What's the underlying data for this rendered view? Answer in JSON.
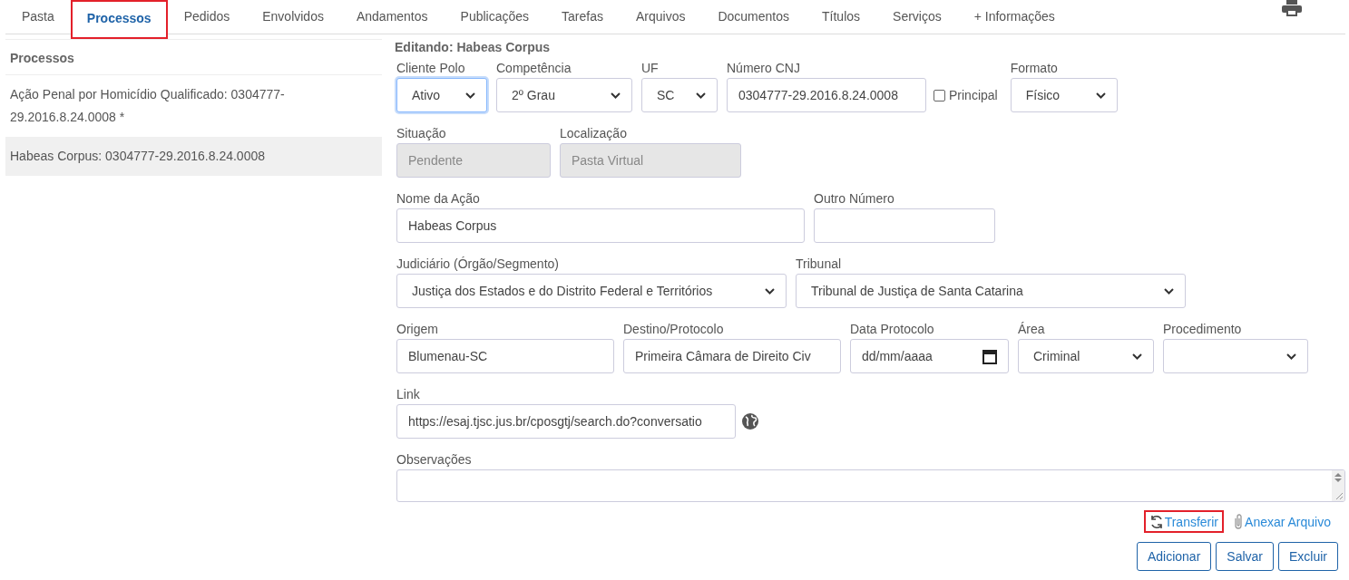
{
  "tabs": [
    {
      "label": "Pasta",
      "selected": false,
      "highlighted": false
    },
    {
      "label": "Processos",
      "selected": true,
      "highlighted": true
    },
    {
      "label": "Pedidos",
      "selected": false,
      "highlighted": false
    },
    {
      "label": "Envolvidos",
      "selected": false,
      "highlighted": false
    },
    {
      "label": "Andamentos",
      "selected": false,
      "highlighted": false
    },
    {
      "label": "Publicações",
      "selected": false,
      "highlighted": false
    },
    {
      "label": "Tarefas",
      "selected": false,
      "highlighted": false
    },
    {
      "label": "Arquivos",
      "selected": false,
      "highlighted": false
    },
    {
      "label": "Documentos",
      "selected": false,
      "highlighted": false
    },
    {
      "label": "Títulos",
      "selected": false,
      "highlighted": false
    },
    {
      "label": "Serviços",
      "selected": false,
      "highlighted": false
    },
    {
      "label": "+ Informações",
      "selected": false,
      "highlighted": false
    }
  ],
  "sidebar": {
    "title": "Processos",
    "items": [
      {
        "label": "Ação Penal por Homicídio Qualificado: 0304777-29.2016.8.24.0008 *",
        "selected": false
      },
      {
        "label": "Habeas Corpus: 0304777-29.2016.8.24.0008",
        "selected": true
      }
    ]
  },
  "form": {
    "title": "Editando: Habeas Corpus",
    "rows": [
      {
        "fields": [
          {
            "kind": "select",
            "label": "Cliente Polo",
            "value": "Ativo",
            "focused": true
          },
          {
            "kind": "select",
            "label": "Competência",
            "value": "2º Grau",
            "focused": false
          },
          {
            "kind": "select",
            "label": "UF",
            "value": "SC",
            "focused": false
          },
          {
            "kind": "input",
            "label": "Número CNJ",
            "value": "0304777-29.2016.8.24.0008",
            "focused": false,
            "checkbox": {
              "label": "Principal",
              "checked": false
            }
          },
          {
            "kind": "select",
            "label": "Formato",
            "value": "Físico",
            "focused": false
          }
        ]
      },
      {
        "fields": [
          {
            "kind": "disabled",
            "label": "Situação",
            "value": "Pendente",
            "focused": false
          },
          {
            "kind": "disabled",
            "label": "Localização",
            "value": "Pasta Virtual",
            "focused": false
          }
        ]
      },
      {
        "fields": [
          {
            "kind": "input",
            "label": "Nome da Ação",
            "value": "Habeas Corpus",
            "focused": false
          },
          {
            "kind": "input",
            "label": "Outro Número",
            "focused": false
          }
        ]
      },
      {
        "fields": [
          {
            "kind": "select",
            "label": "Judiciário (Órgão/Segmento)",
            "value": "Justiça dos Estados e do Distrito Federal e Territórios",
            "focused": false
          },
          {
            "kind": "select",
            "label": "Tribunal",
            "value": "Tribunal de Justiça de Santa Catarina",
            "focused": false
          }
        ]
      },
      {
        "fields": [
          {
            "kind": "input",
            "label": "Origem",
            "value": "Blumenau-SC",
            "focused": false
          },
          {
            "kind": "input",
            "label": "Destino/Protocolo",
            "value": "Primeira Câmara de Direito Civ",
            "focused": false
          },
          {
            "kind": "date",
            "label": "Data Protocolo",
            "placeholder": "dd/mm/aaaa",
            "focused": false
          },
          {
            "kind": "select",
            "label": "Área",
            "value": "Criminal",
            "focused": false
          },
          {
            "kind": "select",
            "label": "Procedimento",
            "focused": false
          }
        ]
      },
      {
        "fields": [
          {
            "kind": "url",
            "label": "Link",
            "value": "https://esaj.tjsc.jus.br/cposgtj/search.do?conversatio",
            "focused": false
          }
        ]
      },
      {
        "fields": [
          {
            "kind": "textarea",
            "label": "Observações",
            "focused": false
          }
        ]
      }
    ]
  },
  "actions": [
    {
      "kind": "transfer",
      "label": "Transferir",
      "highlighted": true
    },
    {
      "kind": "attach",
      "label": "Anexar Arquivo",
      "highlighted": false
    }
  ],
  "buttons": [
    "Adicionar",
    "Salvar",
    "Excluir"
  ]
}
